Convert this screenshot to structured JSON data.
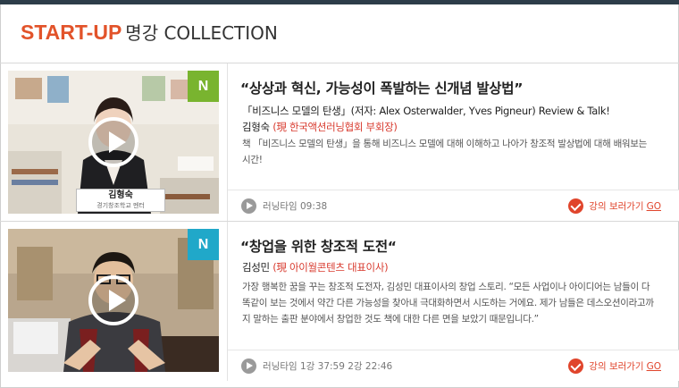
{
  "header": {
    "brand": "START-UP",
    "subtitle": "명강 COLLECTION"
  },
  "courses": [
    {
      "badge": "N",
      "title": "“상상과 혁신, 가능성이 폭발하는 신개념 발상법”",
      "book_prefix": "「비즈니스 모델의 탄생」",
      "book_detail": "(저자: Alex Osterwalder, Yves Pigneur) Review & Talk!",
      "instructor_name": "김형숙",
      "instructor_role": "(現 한국액션러닝협회 부회장)",
      "description": "책 「비즈니스 모델의 탄생」을 통해 비즈니스 모델에 대해 이해하고 나아가 창조적 발상법에 대해 배워보는 시간!",
      "nametag_name": "김형숙",
      "nametag_role": "경기창조학교 멘터",
      "runtime": "러닝타임 09:38",
      "go_label": "강의 보러가기",
      "go_text": "GO"
    },
    {
      "badge": "N",
      "title": "“창업을 위한 창조적 도전“",
      "instructor_name": "김성민",
      "instructor_role": "(現 아이월콘텐츠 대표이사)",
      "description": "가장 행복한 꿈을 꾸는 창조적 도전자, 김성민 대표이사의 창업 스토리. “모든 사업이나 아이디어는 남들이 다 똑같이 보는 것에서 약간 다른 가능성을 찾아내 극대화하면서 시도하는 거에요. 제가 남들은 데스오션이라고까지 말하는 출판 분야에서 창업한 것도 책에 대한 다른 면을 보았기 때문입니다.”",
      "runtime": "러닝타임 1강 37:59  2강 22:46",
      "go_label": "강의 보러가기",
      "go_text": "GO"
    }
  ],
  "colors": {
    "brand": "#e2532a",
    "accent_red": "#e0452c",
    "badge_green": "#79b42f",
    "badge_teal": "#20a8c9",
    "topbar": "#2d3d49"
  }
}
